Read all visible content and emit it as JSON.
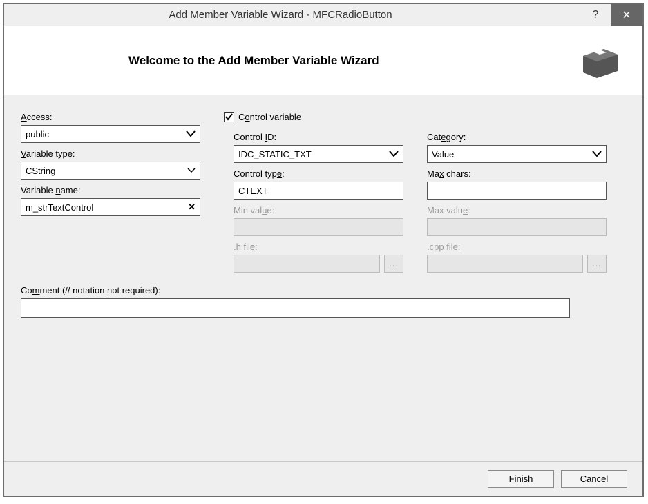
{
  "window": {
    "title": "Add Member Variable Wizard - MFCRadioButton",
    "help_symbol": "?",
    "close_symbol": "✕"
  },
  "banner": {
    "heading": "Welcome to the Add Member Variable Wizard"
  },
  "labels": {
    "access": "Access:",
    "variable_type": "Variable type:",
    "variable_name": "Variable name:",
    "control_variable": "Control variable",
    "control_id": "Control ID:",
    "control_type": "Control type:",
    "min_value": "Min value:",
    "h_file": ".h file:",
    "category": "Category:",
    "max_chars": "Max chars:",
    "max_value": "Max value:",
    "cpp_file": ".cpp file:",
    "comment": "Comment (// notation not required):"
  },
  "values": {
    "access": "public",
    "variable_type": "CString",
    "variable_name": "m_strTextControl",
    "control_variable_checked": true,
    "control_id": "IDC_STATIC_TXT",
    "control_type": "CTEXT",
    "min_value": "",
    "h_file": "",
    "category": "Value",
    "max_chars": "",
    "max_value": "",
    "cpp_file": "",
    "comment": ""
  },
  "buttons": {
    "browse": "...",
    "finish": "Finish",
    "cancel": "Cancel"
  }
}
